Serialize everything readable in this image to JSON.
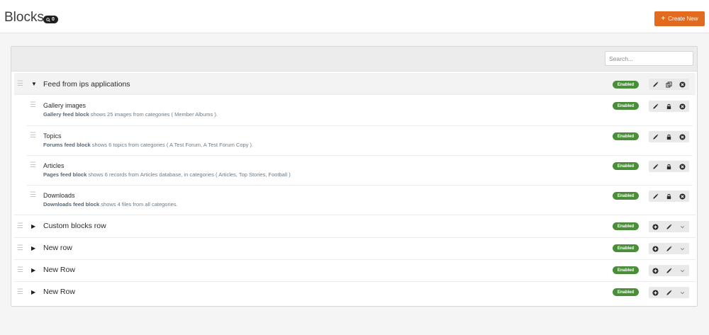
{
  "header": {
    "title": "Blocks",
    "badge_count": "0",
    "create_label": "Create New"
  },
  "search": {
    "placeholder": "Search..."
  },
  "status_label": "Enabled",
  "rows": [
    {
      "title": "Feed from ips applications",
      "expanded": true
    },
    {
      "title": "Custom blocks row",
      "expanded": false
    },
    {
      "title": "New row",
      "expanded": false
    },
    {
      "title": "New Row",
      "expanded": false
    },
    {
      "title": "New Row",
      "expanded": false
    }
  ],
  "blocks": [
    {
      "title": "Gallery images",
      "type": "Gallery feed block",
      "desc": " shows 25 images from categories ( Member Albums )."
    },
    {
      "title": "Topics",
      "type": "Forums feed block",
      "desc": " shows 6 topics from categories ( A Test Forum, A Test Forum Copy )."
    },
    {
      "title": "Articles",
      "type": "Pages feed block",
      "desc": " shows 6 records from Articles database, in categories ( Articles, Top Stories, Football )"
    },
    {
      "title": "Downloads",
      "type": "Downloads feed block",
      "desc": " shows 4 files from all categories."
    }
  ],
  "icons": {
    "drag": "drag-handle-icon",
    "expanded": "caret-down-icon",
    "collapsed": "caret-right-icon",
    "edit": "pencil-icon",
    "copy": "copy-icon",
    "delete": "close-circle-icon",
    "lock": "lock-icon",
    "add": "plus-circle-icon",
    "more": "chevron-down-icon",
    "search_badge": "search-icon"
  },
  "colors": {
    "accent": "#e26b20",
    "status_enabled": "#4a8e3a"
  }
}
